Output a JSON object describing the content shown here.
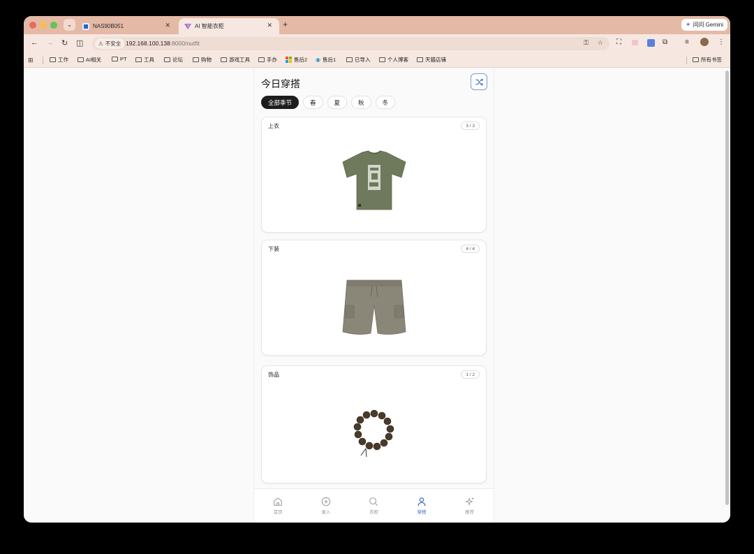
{
  "browser": {
    "tabs": [
      {
        "title": "NAS90B051"
      },
      {
        "title": "AI 智能衣柜"
      }
    ],
    "gemini_label": "问问 Gemini",
    "security_label": "不安全",
    "url_host": "192.168.100.138",
    "url_path": ":8000/outfit",
    "bookmarks": [
      "工作",
      "AI相关",
      "PT",
      "工具",
      "论坛",
      "购物",
      "游戏工具",
      "手办",
      "售后2",
      "售后1",
      "已导入",
      "个人博客",
      "天猫店铺"
    ],
    "all_bookmarks_label": "所有书签"
  },
  "page": {
    "title": "今日穿搭",
    "season_filters": [
      "全部季节",
      "春",
      "夏",
      "秋",
      "冬"
    ],
    "active_season": "全部季节",
    "sections": [
      {
        "title": "上衣",
        "count": "3 / 3",
        "item": "tshirt"
      },
      {
        "title": "下装",
        "count": "4 / 4",
        "item": "shorts"
      },
      {
        "title": "饰品",
        "count": "1 / 2",
        "item": "bracelet"
      }
    ]
  },
  "bottom_nav": {
    "items": [
      {
        "label": "首页",
        "icon": "home-icon"
      },
      {
        "label": "录入",
        "icon": "plus-circle-icon"
      },
      {
        "label": "衣柜",
        "icon": "search-icon"
      },
      {
        "label": "穿搭",
        "icon": "person-icon"
      },
      {
        "label": "推荐",
        "icon": "sparkle-icon"
      }
    ],
    "active": "穿搭"
  },
  "colors": {
    "accent": "#3a63c9",
    "tab_strip": "#e4b9a6",
    "toolbar": "#f6e8e1",
    "active_chip": "#1d1d1d",
    "tshirt": "#6f7a5c",
    "shorts": "#8a8778"
  }
}
